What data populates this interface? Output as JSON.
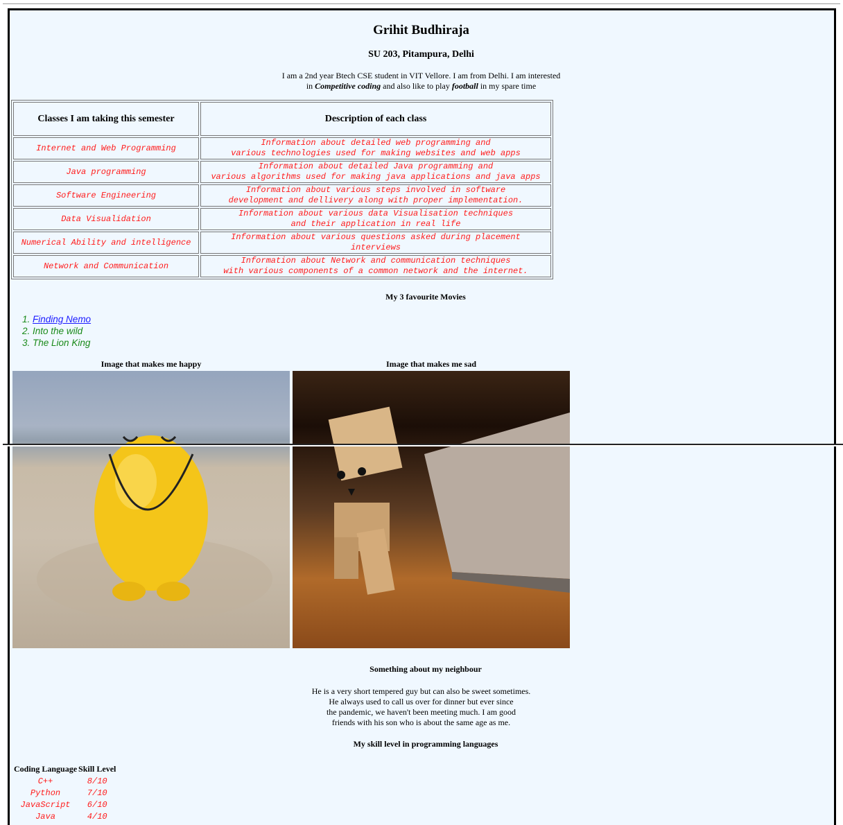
{
  "header": {
    "name": "Grihit Budhiraja",
    "address": "SU 203, Pitampura, Delhi",
    "about_line1": "I am a 2nd year Btech CSE student in VIT Vellore. I am from Delhi. I am interested",
    "about_line2_pre": "in ",
    "about_em1": "Competitive coding",
    "about_line2_mid": " and also like to play ",
    "about_em2": "football",
    "about_line2_post": " in my spare time"
  },
  "classes_table": {
    "headers": [
      "Classes I am taking this semester",
      "Description of each class"
    ],
    "rows": [
      {
        "name": "Internet and Web Programming",
        "desc1": "Information about detailed web programming and",
        "desc2": "various technologies used for making websites and web apps"
      },
      {
        "name": "Java programming",
        "desc1": "Information about detailed Java programming and",
        "desc2": "various algorithms used for making java applications and java apps"
      },
      {
        "name": "Software Engineering",
        "desc1": "Information about various steps involved in software",
        "desc2": "development and dellivery along with proper implementation."
      },
      {
        "name": "Data Visualidation",
        "desc1": "Information about various data Visualisation techniques",
        "desc2": "and their application in real life"
      },
      {
        "name": "Numerical Ability and intelligence",
        "desc1": "Information about various questions asked during placement",
        "desc2": "interviews"
      },
      {
        "name": "Network and Communication",
        "desc1": "Information about Network and communication techniques",
        "desc2": "with various components of a common network and the internet."
      }
    ]
  },
  "movies": {
    "title": "My 3 favourite Movies",
    "items": [
      {
        "num": "1.",
        "label": "Finding Nemo",
        "link": true
      },
      {
        "num": "2.",
        "label": "Into the wild",
        "link": false
      },
      {
        "num": "3.",
        "label": "The Lion King",
        "link": false
      }
    ]
  },
  "images": {
    "happy_caption": "Image that makes me happy",
    "sad_caption": "Image that makes me sad"
  },
  "neighbour": {
    "title": "Something about my neighbour",
    "line1": "He is a very short tempered guy but can also be sweet sometimes.",
    "line2": "He always used to call us over for dinner but ever since",
    "line3": "the pandemic, we haven't been meeting much. I am good",
    "line4": "friends with his son who is about the same age as me."
  },
  "skills": {
    "title": "My skill level in programming languages",
    "headers": [
      "Coding Language",
      "Skill Level"
    ],
    "rows": [
      {
        "lang": "C++",
        "level": "8/10"
      },
      {
        "lang": "Python",
        "level": "7/10"
      },
      {
        "lang": "JavaScript",
        "level": "6/10"
      },
      {
        "lang": "Java",
        "level": "4/10"
      }
    ]
  },
  "colors": {
    "page_bg": "#f0f8ff",
    "table_text": "#ff1a1a",
    "movie_text": "#1a8a1a",
    "link": "#1a1aff"
  }
}
